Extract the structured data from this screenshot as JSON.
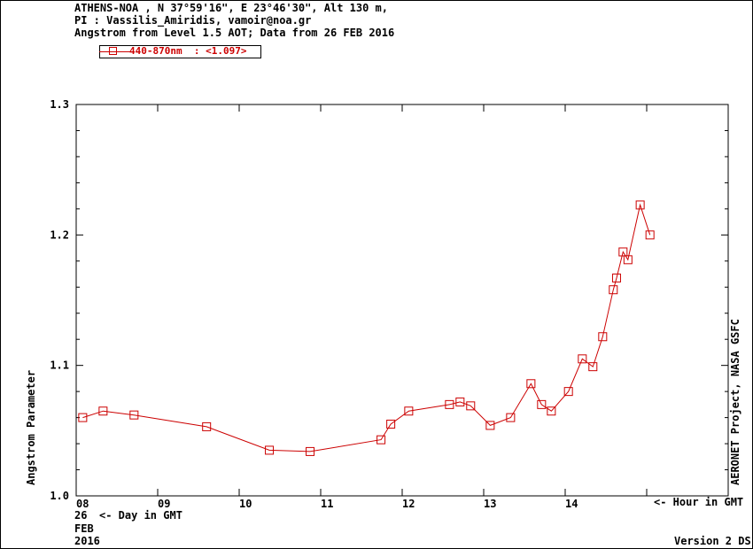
{
  "header": {
    "line1": "ATHENS-NOA , N 37°59'16\", E 23°46'30\", Alt 130 m,",
    "line2": "PI : Vassilis_Amiridis, vamoir@noa.gr",
    "line3": "Angstrom from Level 1.5 AOT; Data from 26 FEB 2016"
  },
  "legend": {
    "label": "440-870nm  : <1.097>",
    "color": "#cc0000"
  },
  "footer": {
    "day": "26",
    "day_hint": "<- Day in GMT",
    "month": "FEB",
    "year": "2016",
    "hour_hint": "<- Hour in GMT",
    "version": "Version 2 DS"
  },
  "side_label": "AERONET Project, NASA GSFC",
  "chart_data": {
    "type": "line",
    "ylabel": "Angstrom Parameter",
    "xlabel": "",
    "ylim": [
      1.0,
      1.3
    ],
    "xlim": [
      8.0,
      16.0
    ],
    "y_ticks": [
      "1.0",
      "1.1",
      "1.2",
      "1.3"
    ],
    "x_ticks": [
      "08",
      "09",
      "10",
      "11",
      "12",
      "13",
      "14"
    ],
    "series": [
      {
        "name": "440-870nm",
        "color": "#cc0000",
        "x": [
          8.08,
          8.33,
          8.71,
          9.6,
          10.37,
          10.87,
          11.74,
          11.86,
          12.08,
          12.58,
          12.71,
          12.84,
          13.08,
          13.33,
          13.58,
          13.71,
          13.83,
          14.04,
          14.21,
          14.34,
          14.46,
          14.59,
          14.63,
          14.71,
          14.77,
          14.92,
          15.04
        ],
        "values": [
          1.06,
          1.065,
          1.062,
          1.053,
          1.035,
          1.034,
          1.043,
          1.055,
          1.065,
          1.07,
          1.072,
          1.069,
          1.054,
          1.06,
          1.086,
          1.07,
          1.065,
          1.08,
          1.105,
          1.099,
          1.122,
          1.158,
          1.167,
          1.187,
          1.181,
          1.223,
          1.2
        ]
      }
    ]
  }
}
